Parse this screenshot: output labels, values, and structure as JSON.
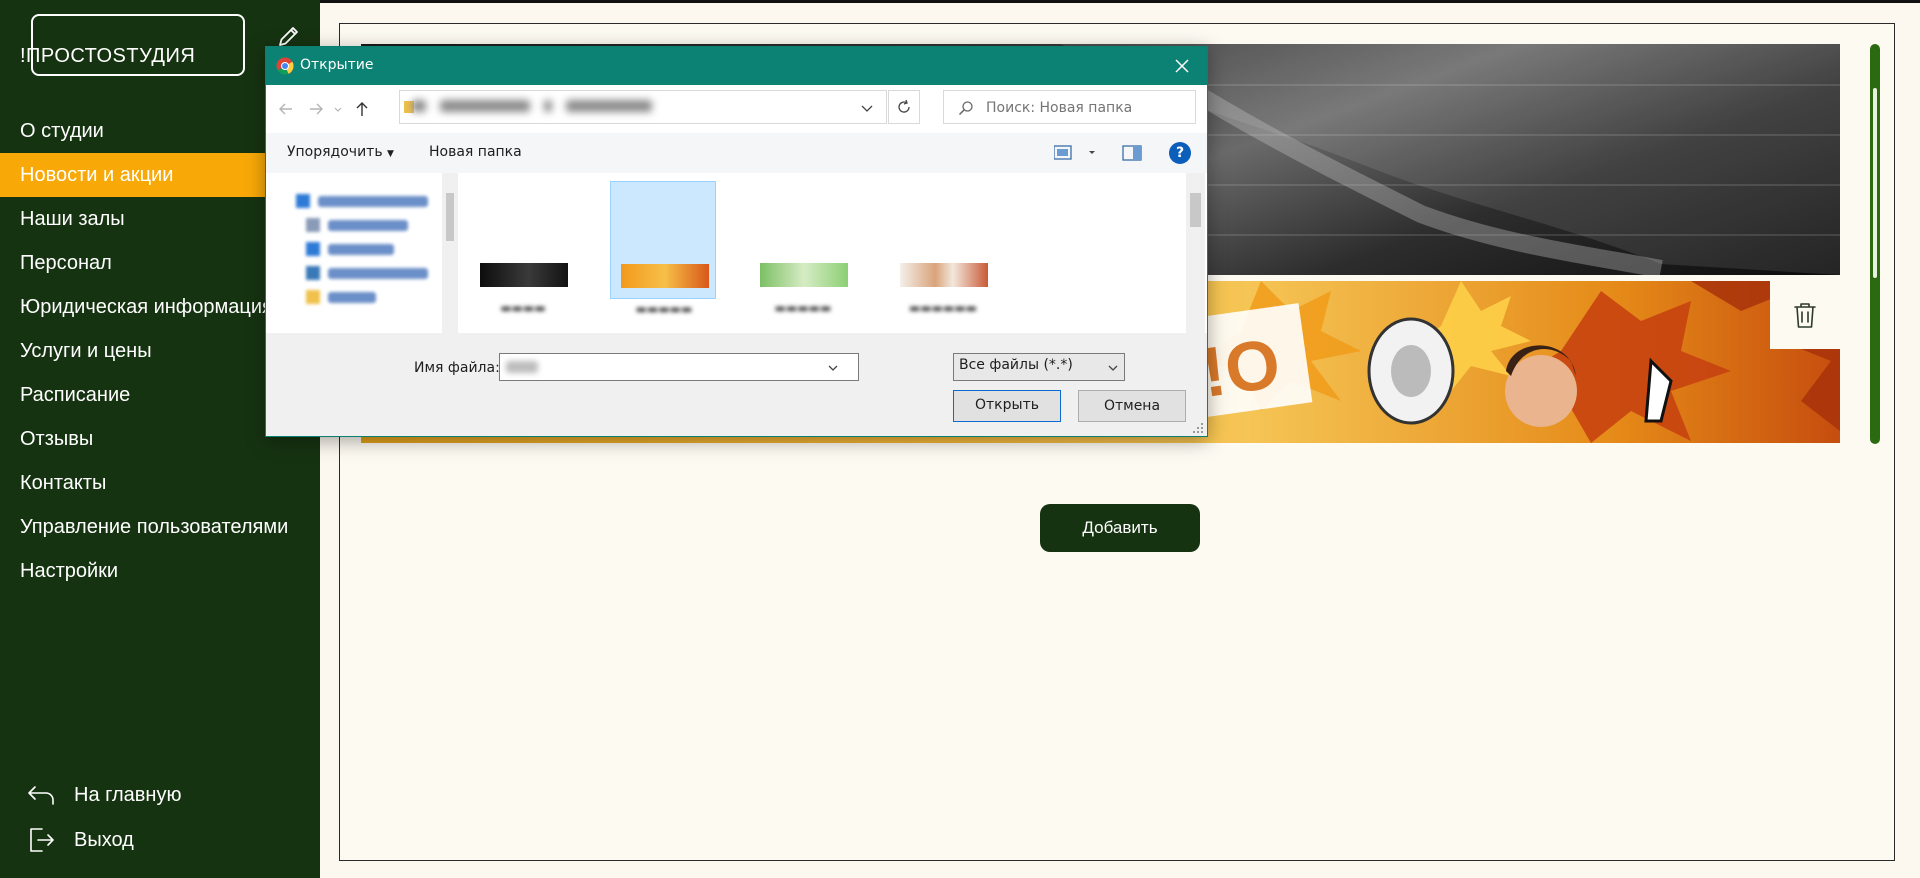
{
  "sidebar": {
    "logo_text": "!ПРОСТОSТУДИЯ",
    "items": [
      {
        "label": "О студии"
      },
      {
        "label": "Новости и акции"
      },
      {
        "label": "Наши залы"
      },
      {
        "label": "Персонал"
      },
      {
        "label": "Юридическая информация"
      },
      {
        "label": "Услуги и цены"
      },
      {
        "label": "Расписание"
      },
      {
        "label": "Отзывы"
      },
      {
        "label": "Контакты"
      },
      {
        "label": "Управление пользователями"
      },
      {
        "label": "Настройки"
      }
    ],
    "home_label": "На главную",
    "logout_label": "Выход",
    "colors": {
      "bg": "#163311",
      "active": "#f8a908"
    }
  },
  "main": {
    "add_label": "Добавить"
  },
  "dialog": {
    "title": "Открытие",
    "search_placeholder": "Поиск: Новая папка",
    "toolbar": {
      "organize_label": "Упорядочить",
      "new_folder_label": "Новая папка"
    },
    "filename_label": "Имя файла:",
    "filter_value": "Все файлы (*.*)",
    "open_label": "Открыть",
    "cancel_label": "Отмена",
    "accent": "#0b8273"
  }
}
